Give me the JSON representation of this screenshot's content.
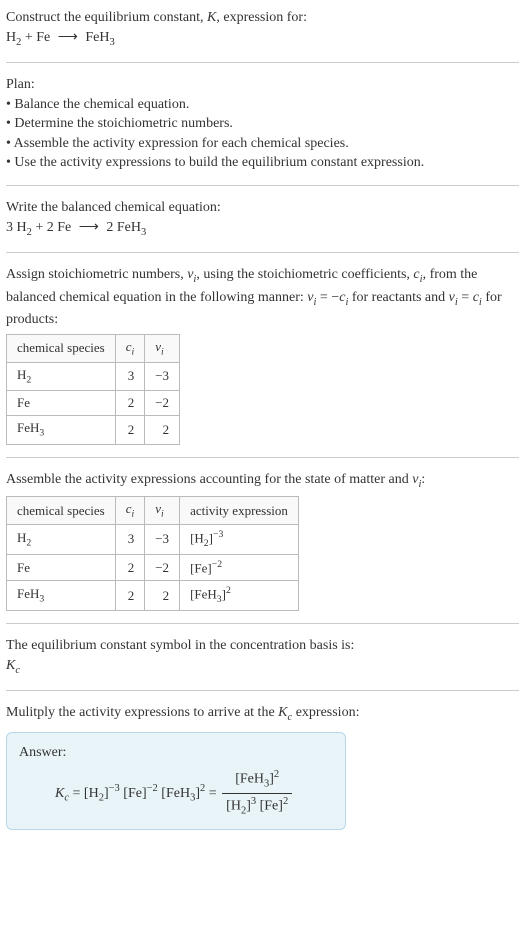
{
  "header": {
    "construct_line": "Construct the equilibrium constant, ",
    "K": "K",
    "construct_line_end": ", expression for:",
    "equation_lhs": "H",
    "equation_lhs_sub": "2",
    "equation_plus": " + Fe",
    "arrow": "⟶",
    "equation_rhs": "FeH",
    "equation_rhs_sub": "3"
  },
  "plan": {
    "title": "Plan:",
    "bullet1": "• Balance the chemical equation.",
    "bullet2": "• Determine the stoichiometric numbers.",
    "bullet3": "• Assemble the activity expression for each chemical species.",
    "bullet4": "• Use the activity expressions to build the equilibrium constant expression."
  },
  "balanced": {
    "title": "Write the balanced chemical equation:",
    "coef1": "3 H",
    "coef1_sub": "2",
    "plus": " + 2 Fe",
    "arrow": "⟶",
    "rhs": "2 FeH",
    "rhs_sub": "3"
  },
  "assign": {
    "text1": "Assign stoichiometric numbers, ",
    "nu_i": "ν",
    "nu_i_sub": "i",
    "text2": ", using the stoichiometric coefficients, ",
    "c_i": "c",
    "c_i_sub": "i",
    "text3": ", from the balanced chemical equation in the following manner: ",
    "eq1_lhs": "ν",
    "eq1_lhs_sub": "i",
    "eq1_mid": " = −",
    "eq1_rhs": "c",
    "eq1_rhs_sub": "i",
    "text4": " for reactants and ",
    "eq2_lhs": "ν",
    "eq2_lhs_sub": "i",
    "eq2_mid": " = ",
    "eq2_rhs": "c",
    "eq2_rhs_sub": "i",
    "text5": " for products:"
  },
  "table1": {
    "headers": {
      "species": "chemical species",
      "c": "c",
      "c_sub": "i",
      "nu": "ν",
      "nu_sub": "i"
    },
    "rows": [
      {
        "species": "H",
        "species_sub": "2",
        "c": "3",
        "nu": "−3"
      },
      {
        "species": "Fe",
        "species_sub": "",
        "c": "2",
        "nu": "−2"
      },
      {
        "species": "FeH",
        "species_sub": "3",
        "c": "2",
        "nu": "2"
      }
    ]
  },
  "assemble": {
    "text1": "Assemble the activity expressions accounting for the state of matter and ",
    "nu": "ν",
    "nu_sub": "i",
    "text2": ":"
  },
  "table2": {
    "headers": {
      "species": "chemical species",
      "c": "c",
      "c_sub": "i",
      "nu": "ν",
      "nu_sub": "i",
      "activity": "activity expression"
    },
    "rows": [
      {
        "species": "H",
        "species_sub": "2",
        "c": "3",
        "nu": "−3",
        "act_open": "[H",
        "act_sub": "2",
        "act_close": "]",
        "act_sup": "−3"
      },
      {
        "species": "Fe",
        "species_sub": "",
        "c": "2",
        "nu": "−2",
        "act_open": "[Fe",
        "act_sub": "",
        "act_close": "]",
        "act_sup": "−2"
      },
      {
        "species": "FeH",
        "species_sub": "3",
        "c": "2",
        "nu": "2",
        "act_open": "[FeH",
        "act_sub": "3",
        "act_close": "]",
        "act_sup": "2"
      }
    ]
  },
  "symbol": {
    "text": "The equilibrium constant symbol in the concentration basis is:",
    "K": "K",
    "K_sub": "c"
  },
  "multiply": {
    "text1": "Mulitply the activity expressions to arrive at the ",
    "K": "K",
    "K_sub": "c",
    "text2": " expression:"
  },
  "answer": {
    "label": "Answer:",
    "K": "K",
    "K_sub": "c",
    "eq": " = ",
    "t1": "[H",
    "t1_sub": "2",
    "t1_close": "]",
    "t1_sup": "−3",
    "t2": " [Fe]",
    "t2_sup": "−2",
    "t3": " [FeH",
    "t3_sub": "3",
    "t3_close": "]",
    "t3_sup": "2",
    "eq2": " = ",
    "frac_num": "[FeH",
    "frac_num_sub": "3",
    "frac_num_close": "]",
    "frac_num_sup": "2",
    "frac_den1": "[H",
    "frac_den1_sub": "2",
    "frac_den1_close": "]",
    "frac_den1_sup": "3",
    "frac_den2": " [Fe]",
    "frac_den2_sup": "2"
  }
}
